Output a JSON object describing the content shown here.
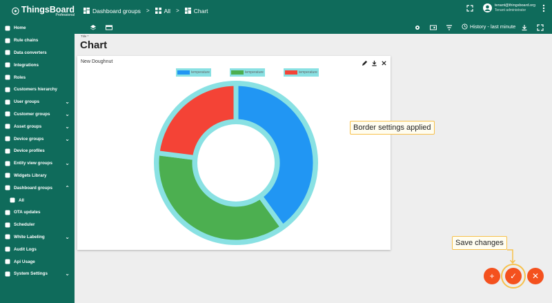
{
  "app": {
    "logo_text": "ThingsBoard",
    "logo_sub": "Professional"
  },
  "topbar": {
    "breadcrumbs": [
      "Dashboard groups",
      "All",
      "Chart"
    ],
    "user_name": "tenant@thingsboard.org",
    "user_role": "Tenant administrator"
  },
  "sidebar": {
    "items": [
      {
        "label": "Home",
        "icon": "home-icon",
        "chevron": ""
      },
      {
        "label": "Rule chains",
        "icon": "code-icon",
        "chevron": ""
      },
      {
        "label": "Data converters",
        "icon": "transform-icon",
        "chevron": ""
      },
      {
        "label": "Integrations",
        "icon": "input-icon",
        "chevron": ""
      },
      {
        "label": "Roles",
        "icon": "shield-icon",
        "chevron": ""
      },
      {
        "label": "Customers hierarchy",
        "icon": "sort-icon",
        "chevron": ""
      },
      {
        "label": "User groups",
        "icon": "account-icon",
        "chevron": "⌄"
      },
      {
        "label": "Customer groups",
        "icon": "people-icon",
        "chevron": "⌄"
      },
      {
        "label": "Asset groups",
        "icon": "domain-icon",
        "chevron": "⌄"
      },
      {
        "label": "Device groups",
        "icon": "devices-icon",
        "chevron": "⌄"
      },
      {
        "label": "Device profiles",
        "icon": "card-icon",
        "chevron": ""
      },
      {
        "label": "Entity view groups",
        "icon": "view-icon",
        "chevron": "⌄"
      },
      {
        "label": "Widgets Library",
        "icon": "widgets-icon",
        "chevron": ""
      },
      {
        "label": "Dashboard groups",
        "icon": "dashboard-icon",
        "chevron": "⌃"
      },
      {
        "label": "All",
        "icon": "grid-icon",
        "chevron": "",
        "sub": true
      },
      {
        "label": "OTA updates",
        "icon": "update-icon",
        "chevron": ""
      },
      {
        "label": "Scheduler",
        "icon": "clock-icon",
        "chevron": ""
      },
      {
        "label": "White Labeling",
        "icon": "format-paint-icon",
        "chevron": "⌄"
      },
      {
        "label": "Audit Logs",
        "icon": "audit-icon",
        "chevron": ""
      },
      {
        "label": "Api Usage",
        "icon": "chart-icon",
        "chevron": ""
      },
      {
        "label": "System Settings",
        "icon": "settings-icon",
        "chevron": "⌄"
      }
    ]
  },
  "toolbar": {
    "history_label": "History - last minute"
  },
  "main": {
    "title_label": "Title *",
    "title": "Chart"
  },
  "widget": {
    "title": "New Doughnut"
  },
  "tooltips": {
    "border": "Border settings applied",
    "save": "Save changes"
  },
  "fabs": {
    "add": "+",
    "save": "✓",
    "cancel": "✕"
  },
  "colors": {
    "primary": "#0f6b5b",
    "accent": "#f4511e",
    "highlight": "#89e1e3"
  },
  "chart_data": {
    "type": "pie",
    "donut": true,
    "legend_position": "top",
    "series": [
      {
        "name": "temperature",
        "value": 40,
        "color": "#2196f3"
      },
      {
        "name": "temperature",
        "value": 37,
        "color": "#4caf50"
      },
      {
        "name": "temperature",
        "value": 23,
        "color": "#f44336"
      }
    ]
  }
}
